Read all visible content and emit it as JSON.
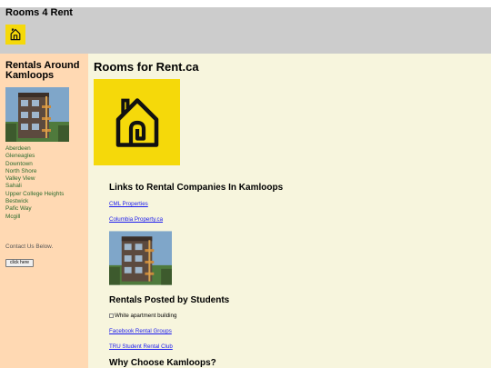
{
  "header": {
    "site_title": "Rooms 4 Rent"
  },
  "sidebar": {
    "title": "Rentals Around Kamloops",
    "photo": "apartment-building-photo",
    "neighbourhoods": [
      "Aberdeen",
      "Gleneagles",
      "Downtown",
      "North Shore",
      "Valley View",
      "Sahali",
      "Upper College Heights",
      "Bestwick",
      "Pafic Way",
      "Mcgill"
    ],
    "contact_text": "Contact Us Below.",
    "button_label": "click here"
  },
  "main": {
    "title": "Rooms for Rent.ca",
    "logo": "house-logo",
    "companies_heading": "Links to Rental Companies In Kamloops",
    "company_links": [
      "CML Properties",
      "Columbia Property.ca"
    ],
    "students_heading": "Rentals Posted by Students",
    "broken_image_alt": "White apartment building",
    "student_links": [
      "Facebook Rental Groups",
      "TRU Student Rental Club"
    ],
    "why_heading": "Why Choose Kamloops?"
  },
  "colors": {
    "header_bg": "#cccccc",
    "sidebar_bg": "#ffd9b3",
    "main_bg": "#f7f5dd",
    "logo_bg": "#f5d90a",
    "nav_text": "#2e6b2e",
    "link": "#1a1aee"
  }
}
